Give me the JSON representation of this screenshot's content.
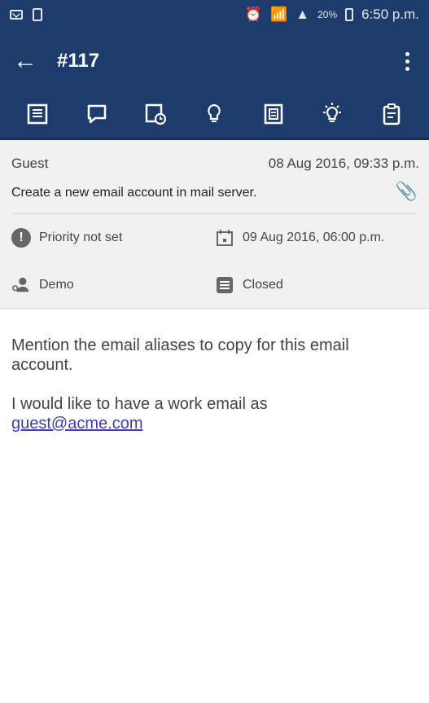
{
  "status_bar": {
    "left_icons": [
      "mail-icon",
      "document-icon"
    ],
    "right_icons": [
      "alarm-icon",
      "wifi-icon",
      "signal-icon"
    ],
    "battery": "20%",
    "time": "6:50 p.m."
  },
  "app_bar": {
    "title": "#117"
  },
  "toolbar": {
    "icons": [
      "details-icon",
      "comment-icon",
      "history-icon",
      "idea-icon",
      "notes-icon",
      "solution-icon",
      "clipboard-icon"
    ]
  },
  "ticket": {
    "requester": "Guest",
    "created": "08 Aug 2016, 09:33 p.m.",
    "subject": "Create a new email account in mail server.",
    "priority": "Priority not set",
    "due": "09 Aug 2016, 06:00 p.m.",
    "assignee": "Demo",
    "status": "Closed"
  },
  "body": {
    "paragraph1": "Mention the email aliases to copy for this email account.",
    "paragraph2_text": "I would like to have a work email as",
    "email_link": "guest@acme.com"
  },
  "colors": {
    "header": "#1d3c6c",
    "panel": "#f1f1f1",
    "link": "#3d3db8"
  }
}
